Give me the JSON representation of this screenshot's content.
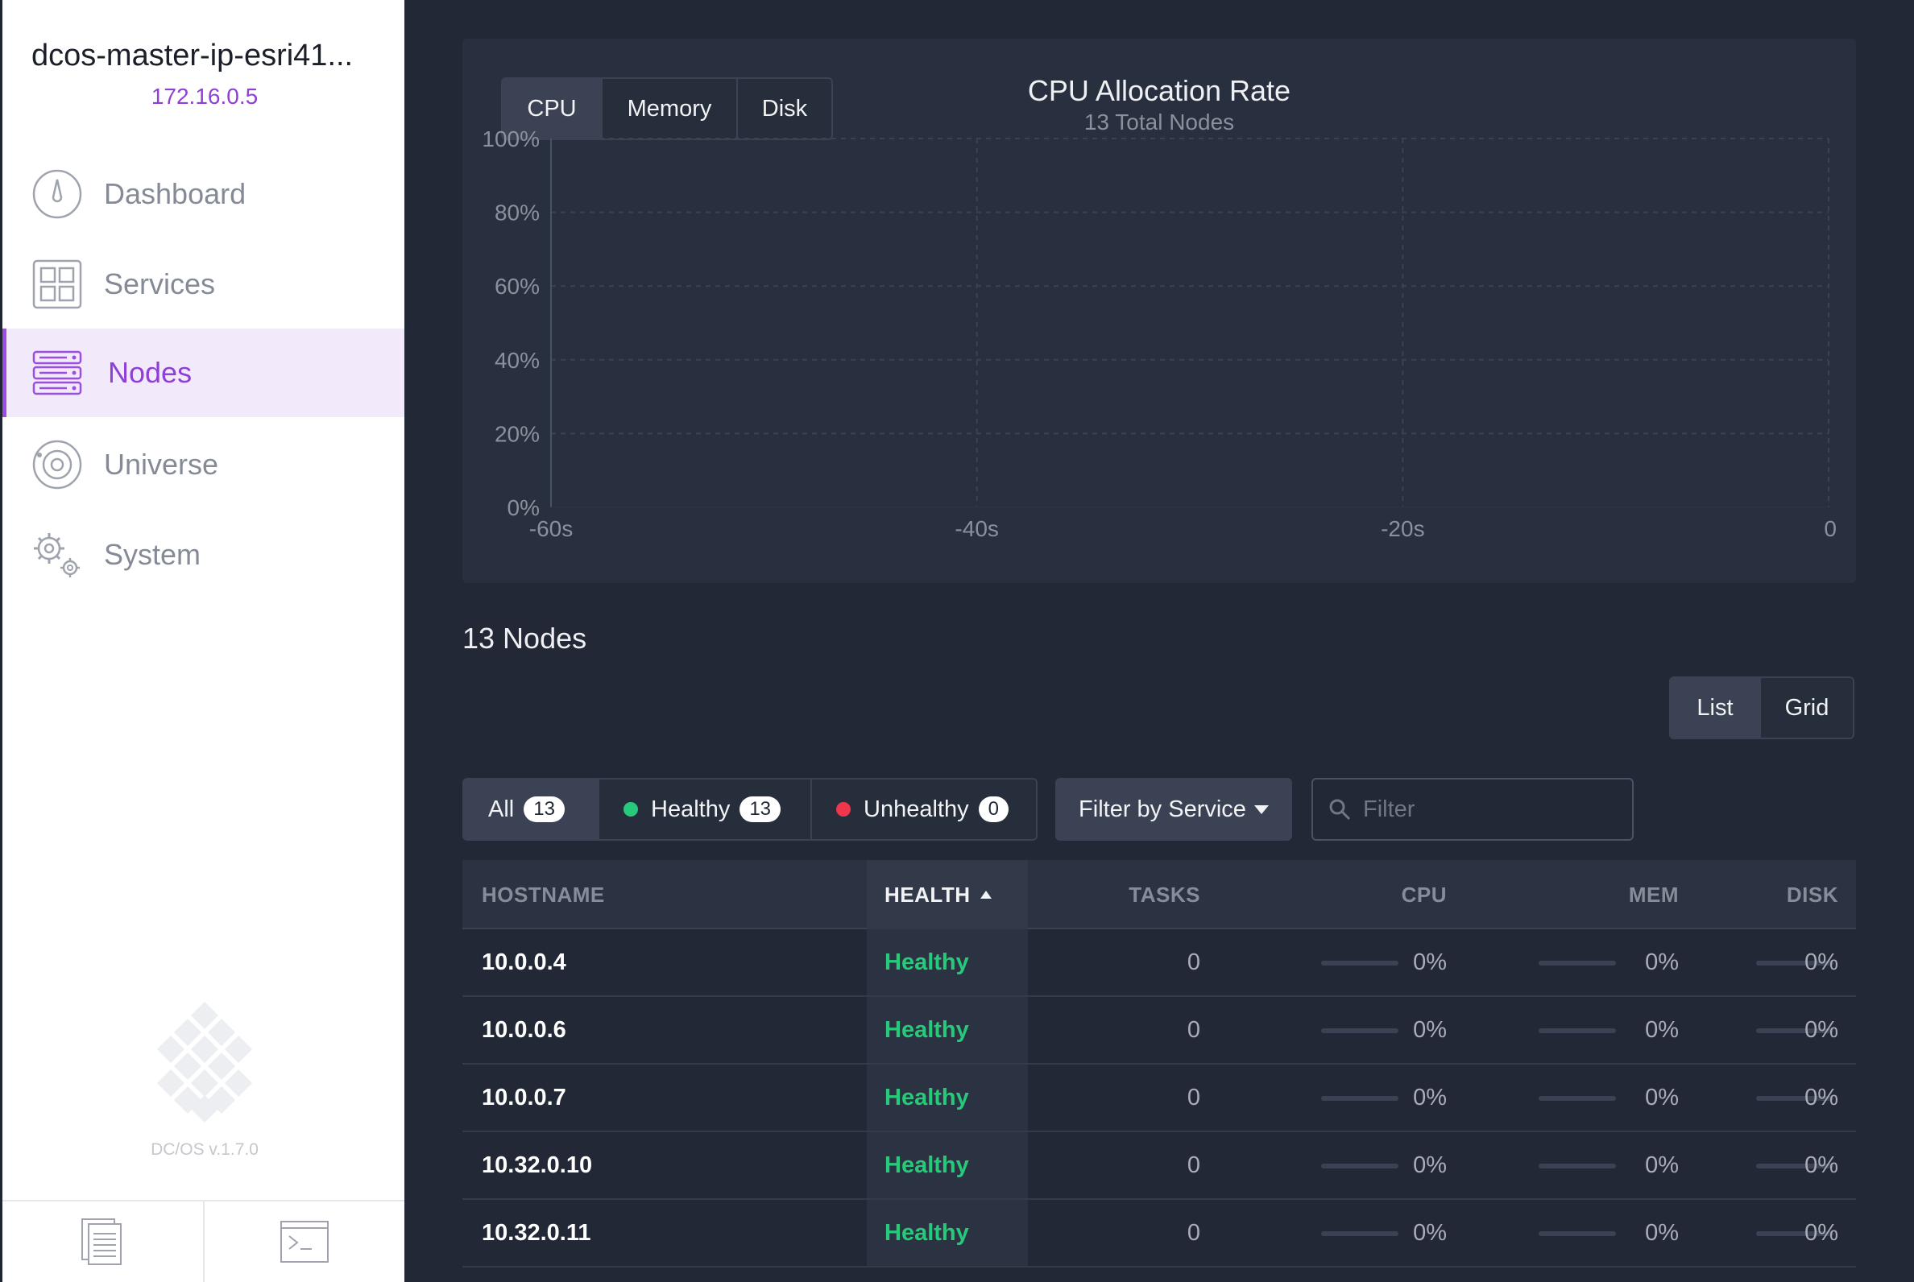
{
  "sidebar": {
    "cluster_name": "dcos-master-ip-esri41...",
    "cluster_ip": "172.16.0.5",
    "items": [
      {
        "label": "Dashboard",
        "icon": "dashboard-icon"
      },
      {
        "label": "Services",
        "icon": "services-icon"
      },
      {
        "label": "Nodes",
        "icon": "nodes-icon",
        "active": true
      },
      {
        "label": "Universe",
        "icon": "universe-icon"
      },
      {
        "label": "System",
        "icon": "system-icon"
      }
    ],
    "version": "DC/OS v.1.7.0",
    "footer": [
      {
        "icon": "documentation-icon"
      },
      {
        "icon": "cli-terminal-icon"
      }
    ]
  },
  "chart_panel": {
    "tabs": [
      "CPU",
      "Memory",
      "Disk"
    ],
    "active_tab": "CPU"
  },
  "chart_data": {
    "type": "line",
    "title": "CPU Allocation Rate",
    "subtitle": "13 Total Nodes",
    "x_ticks": [
      "-60s",
      "-40s",
      "-20s",
      "0"
    ],
    "y_ticks": [
      "100%",
      "80%",
      "60%",
      "40%",
      "20%",
      "0%"
    ],
    "xlim": [
      -60,
      0
    ],
    "ylim": [
      0,
      100
    ],
    "grid": true,
    "series": [
      {
        "x": [
          -60,
          -40,
          -20,
          0
        ],
        "y": [
          0,
          0,
          0,
          0
        ]
      }
    ]
  },
  "nodes": {
    "count_label": "13 Nodes",
    "view_toggle": [
      "List",
      "Grid"
    ],
    "active_view": "List",
    "filters": {
      "all_label": "All",
      "all_count": "13",
      "healthy_label": "Healthy",
      "healthy_count": "13",
      "unhealthy_label": "Unhealthy",
      "unhealthy_count": "0"
    },
    "service_filter_label": "Filter by Service",
    "search_placeholder": "Filter",
    "columns": [
      "HOSTNAME",
      "HEALTH",
      "TASKS",
      "CPU",
      "MEM",
      "DISK"
    ],
    "rows": [
      {
        "hostname": "10.0.0.4",
        "health": "Healthy",
        "tasks": "0",
        "cpu": "0%",
        "mem": "0%",
        "disk": "0%"
      },
      {
        "hostname": "10.0.0.6",
        "health": "Healthy",
        "tasks": "0",
        "cpu": "0%",
        "mem": "0%",
        "disk": "0%"
      },
      {
        "hostname": "10.0.0.7",
        "health": "Healthy",
        "tasks": "0",
        "cpu": "0%",
        "mem": "0%",
        "disk": "0%"
      },
      {
        "hostname": "10.32.0.10",
        "health": "Healthy",
        "tasks": "0",
        "cpu": "0%",
        "mem": "0%",
        "disk": "0%"
      },
      {
        "hostname": "10.32.0.11",
        "health": "Healthy",
        "tasks": "0",
        "cpu": "0%",
        "mem": "0%",
        "disk": "0%"
      }
    ]
  },
  "colors": {
    "accent": "#8f3fd6",
    "healthy": "#27c97a",
    "unhealthy": "#f0364b",
    "background": "#222836"
  }
}
